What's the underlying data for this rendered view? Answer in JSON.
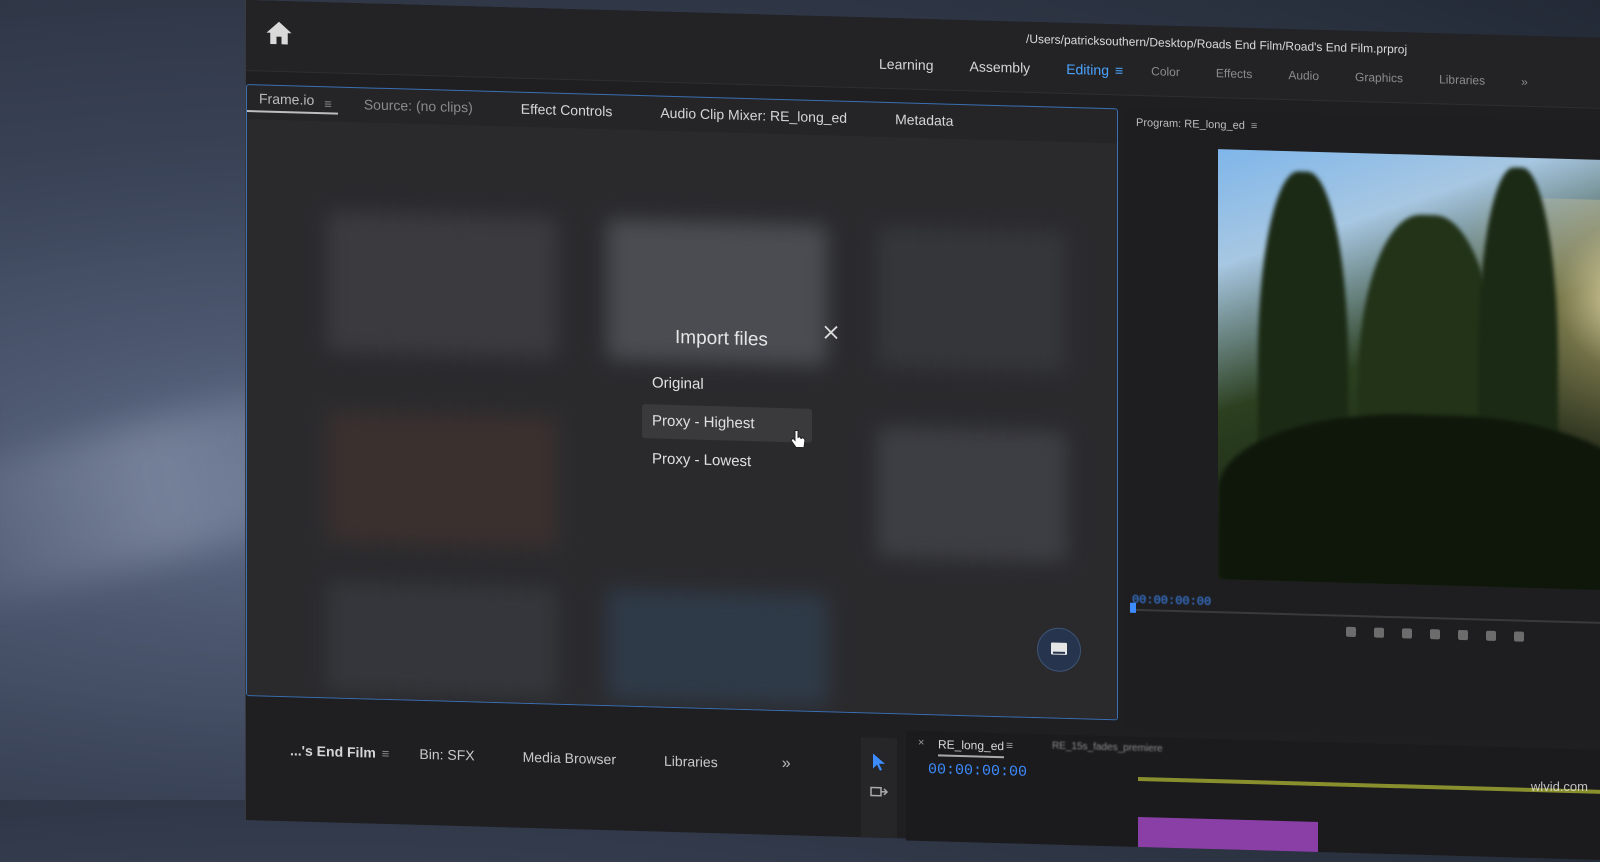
{
  "window": {
    "path_title": "/Users/patricksouthern/Desktop/Roads End Film/Road's End Film.prproj"
  },
  "workspaces": [
    {
      "label": "Learning"
    },
    {
      "label": "Assembly"
    },
    {
      "label": "Editing",
      "active": true
    },
    {
      "label": "Color"
    },
    {
      "label": "Effects"
    },
    {
      "label": "Audio"
    },
    {
      "label": "Graphics"
    },
    {
      "label": "Libraries"
    }
  ],
  "left_panel": {
    "tabs": [
      {
        "label": "Frame.io",
        "active": true
      },
      {
        "label": "Source: (no clips)"
      },
      {
        "label": "Effect Controls"
      },
      {
        "label": "Audio Clip Mixer: RE_long_ed"
      },
      {
        "label": "Metadata"
      }
    ],
    "dialog": {
      "title": "Import files",
      "options": [
        {
          "label": "Original"
        },
        {
          "label": "Proxy - Highest",
          "hover": true
        },
        {
          "label": "Proxy - Lowest"
        }
      ]
    }
  },
  "program_monitor": {
    "title": "Program: RE_long_ed",
    "timecode": "00:00:00:00"
  },
  "bottom_panel": {
    "tabs": [
      {
        "label": "...'s End Film"
      },
      {
        "label": "Bin: SFX"
      },
      {
        "label": "Media Browser"
      },
      {
        "label": "Libraries"
      }
    ]
  },
  "timeline": {
    "sequence_name": "RE_long_ed",
    "timecode": "00:00:00:00",
    "label": "RE_15s_fades_premiere"
  },
  "colors": {
    "accent": "#4ba3ff",
    "timecode": "#3d8cff",
    "panel_border": "#3a6fb3",
    "clip_purple": "#8a3fa6"
  },
  "watermark": "wlvid.com"
}
